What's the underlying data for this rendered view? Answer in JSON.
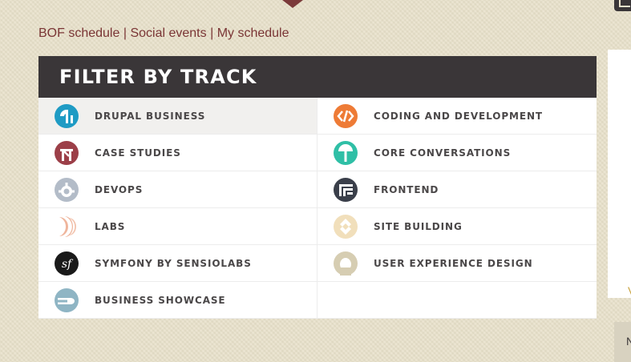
{
  "top_links": [
    {
      "label": "BOF schedule"
    },
    {
      "label": "Social events"
    },
    {
      "label": "My schedule"
    }
  ],
  "separator": "|",
  "panel": {
    "title": "FILTER BY TRACK"
  },
  "tracks": [
    {
      "label": "DRUPAL BUSINESS",
      "icon": "drupal-business-icon",
      "color": "#1f9bc4",
      "active": true
    },
    {
      "label": "CODING AND DEVELOPMENT",
      "icon": "coding-development-icon",
      "color": "#ee7b36",
      "active": false
    },
    {
      "label": "CASE STUDIES",
      "icon": "case-studies-icon",
      "color": "#9c3f48",
      "active": false
    },
    {
      "label": "CORE CONVERSATIONS",
      "icon": "core-conversations-icon",
      "color": "#2fbfa6",
      "active": false
    },
    {
      "label": "DEVOPS",
      "icon": "devops-icon",
      "color": "#b3bcc8",
      "active": false
    },
    {
      "label": "FRONTEND",
      "icon": "frontend-icon",
      "color": "#3a3f4a",
      "active": false
    },
    {
      "label": "LABS",
      "icon": "labs-icon",
      "color": "#efb59c",
      "active": false
    },
    {
      "label": "SITE BUILDING",
      "icon": "site-building-icon",
      "color": "#f1dfbb",
      "active": false
    },
    {
      "label": "SYMFONY BY SENSIOLABS",
      "icon": "symfony-icon",
      "color": "#1a1a1a",
      "active": false
    },
    {
      "label": "USER EXPERIENCE DESIGN",
      "icon": "user-experience-icon",
      "color": "#d6cdb2",
      "active": false
    },
    {
      "label": "BUSINESS SHOWCASE",
      "icon": "business-showcase-icon",
      "color": "#8fb5c4",
      "active": false
    }
  ],
  "side_cutoff": {
    "v_glyph": "V",
    "box_glyph": "N"
  }
}
